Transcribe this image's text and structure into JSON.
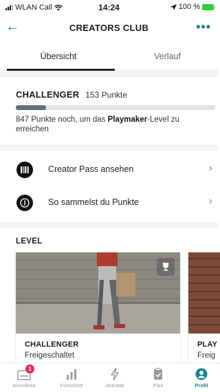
{
  "status_bar": {
    "carrier": "WLAN Call",
    "time": "14:24",
    "battery": "100 %"
  },
  "header": {
    "title": "CREATORS CLUB"
  },
  "tabs": [
    {
      "label": "Übersicht"
    },
    {
      "label": "Verlauf"
    }
  ],
  "challenger": {
    "level": "CHALLENGER",
    "points": "153 Punkte",
    "progress_fraction": 0.153,
    "desc_prefix": "847 Punkte noch, um das ",
    "desc_level": "Playmaker",
    "desc_suffix": "-Level zu erreichen"
  },
  "actions": [
    {
      "label": "Creator Pass ansehen",
      "icon": "barcode-icon"
    },
    {
      "label": "So sammelst du Punkte",
      "icon": "info-icon"
    }
  ],
  "level": {
    "heading": "LEVEL",
    "cards": [
      {
        "name": "CHALLENGER",
        "status": "Freigeschaltet"
      },
      {
        "name": "PLAY",
        "status": "Freig"
      }
    ]
  },
  "bottom_nav": {
    "items": [
      {
        "label": "Newsfeed",
        "icon": "newsfeed-icon",
        "badge": "1"
      },
      {
        "label": "Fortschritt",
        "icon": "bar-chart-icon"
      },
      {
        "label": "Aktivität",
        "icon": "lightning-icon"
      },
      {
        "label": "Plan",
        "icon": "clipboard-icon"
      },
      {
        "label": "Profil",
        "icon": "profile-icon"
      }
    ]
  },
  "colors": {
    "accent": "#1a7f8e",
    "badge": "#e52d4f",
    "progress": "#5d6f7d",
    "battery": "#2ecc40"
  }
}
